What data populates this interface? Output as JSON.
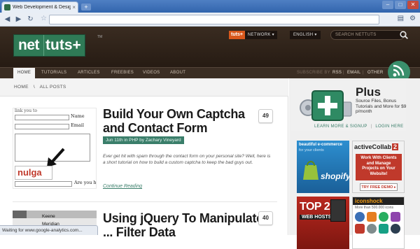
{
  "browser": {
    "tab_title": "Web Development & Design",
    "tab_close": "×",
    "new_tab": "+",
    "status_text": "Waiting for www.google-analytics.com..."
  },
  "header": {
    "logo_net": "net",
    "logo_tuts": "tuts+",
    "logo_tm": "TM",
    "network_logo": "tuts+",
    "network_label": "NETWORK ▾",
    "language": "ENGLISH ▾",
    "search_placeholder": "SEARCH NETTUTS"
  },
  "nav": {
    "items": [
      "HOME",
      "TUTORIALS",
      "ARTICLES",
      "FREEBIES",
      "VIDEOS",
      "ABOUT"
    ],
    "subscribe_label": "SUBSCRIBE BY",
    "rss": "RSS",
    "email": "EMAIL",
    "other": "OTHER",
    "separator": "|"
  },
  "breadcrumb": {
    "home": "HOME",
    "separator": "\\",
    "current": "ALL POSTS"
  },
  "posts": [
    {
      "title_line1": "Build Your Own Captcha",
      "title_line2": "and Contact Form",
      "meta": "Jun 11th in PHP by Zachary Vineyard",
      "excerpt": "Ever get hit with spam through the contact form on your personal site? Well, here is a short tutorial on how to build a custom captcha to keep the bad guys out.",
      "continue": "Continue Reading",
      "comments": "49",
      "thumb_name": "Name",
      "thumb_email": "Email",
      "thumb_captcha": "nulga",
      "thumb_human": "Are you hu",
      "thumb_top": "link you to"
    },
    {
      "title_line1": "Using jQuery To Manipulate",
      "title_line2": "... Filter Data",
      "comments": "40",
      "thumb_row1": "Keene",
      "thumb_row2": "Meridian"
    }
  ],
  "sidebar": {
    "plus_title": "Plus",
    "plus_desc": "Source Files, Bonus Tutorials and More for $9 p/month",
    "learn_more": "LEARN MORE & SIGNUP",
    "login": "LOGIN HERE",
    "link_sep": "|",
    "ads": {
      "shopify_top": "beautiful e-commerce",
      "shopify_sub": "for your clients",
      "shopify_brand": "shopify",
      "ac_brand": "activeCollab",
      "ac_ver": "2",
      "ac_text": "Work With Clients and Manage Projects on Your Website!",
      "ac_btn": "TRY FREE DEMO ▸",
      "top25_num": "TOP 25",
      "top25_sub": "WEB HOSTS",
      "iconshock_brand": "iconshock",
      "iconshock_sub": "More than 500.000 icons"
    }
  },
  "colors": {
    "brand_green": "#2f7a56",
    "header_dark": "#2c2017",
    "accent_orange": "#d9581c"
  }
}
